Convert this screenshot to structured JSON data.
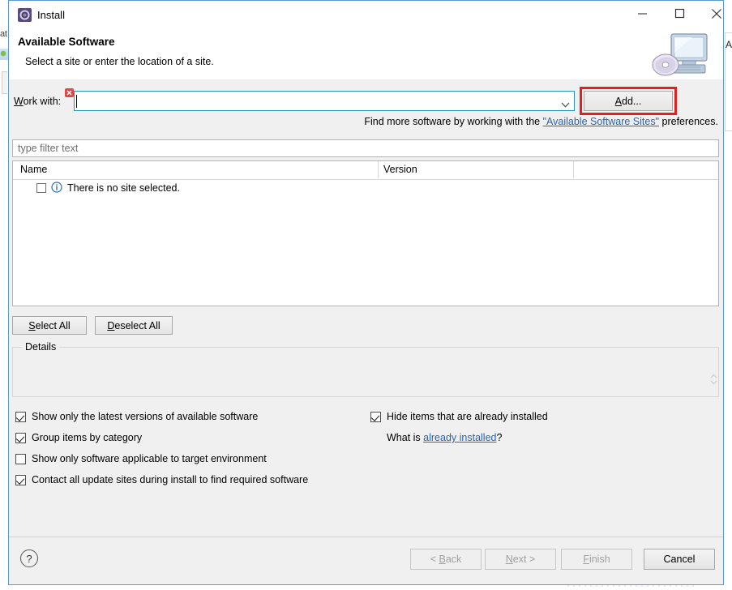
{
  "background": {
    "left_text": "at",
    "right_letter": "A"
  },
  "window": {
    "title": "Install",
    "icon": "install-wizard-icon",
    "minimize_label": "minimize-icon",
    "maximize_label": "maximize-icon",
    "close_label": "close-icon"
  },
  "header": {
    "title": "Available Software",
    "subtitle": "Select a site or enter the location of a site.",
    "banner_icon": "computer-with-cd-icon"
  },
  "work_with": {
    "label_pre": "W",
    "label_mnemonic": "W",
    "label": "Work with:",
    "value": "",
    "error_icon": "error-decoration-icon",
    "dropdown_icon": "chevron-down-icon",
    "add_button": "Add...",
    "add_button_mnemonic": "A",
    "highlight_color": "#e32020"
  },
  "find_more": {
    "prefix": "Find more software by working with the ",
    "link": "\"Available Software Sites\"",
    "suffix": " preferences."
  },
  "filter": {
    "placeholder": "type filter text",
    "value": ""
  },
  "table": {
    "columns": [
      "Name",
      "Version"
    ],
    "rows": [
      {
        "checked": false,
        "icon": "info-icon",
        "name": "There is no site selected.",
        "version": ""
      }
    ]
  },
  "list_buttons": {
    "select_all": "Select All",
    "select_all_mnemonic": "S",
    "deselect_all": "Deselect All",
    "deselect_all_mnemonic": "D"
  },
  "details": {
    "title": "Details",
    "content": "",
    "spinner_icon": "up-down-spinner-icon"
  },
  "options": {
    "left": [
      {
        "label": "Show only the latest versions of available software",
        "checked": true,
        "mnemonic": "l"
      },
      {
        "label": "Group items by category",
        "checked": true,
        "mnemonic": "G"
      },
      {
        "label": "Show only software applicable to target environment",
        "checked": false,
        "mnemonic": ""
      },
      {
        "label": "Contact all update sites during install to find required software",
        "checked": true,
        "mnemonic": "C"
      }
    ],
    "right": [
      {
        "label": "Hide items that are already installed",
        "checked": true,
        "mnemonic": "H"
      }
    ],
    "what_is_prefix": "What is ",
    "what_is_link": "already installed",
    "what_is_suffix": "?"
  },
  "footer": {
    "help_icon": "?",
    "buttons": [
      {
        "label": "< Back",
        "enabled": false,
        "name": "back-button"
      },
      {
        "label": "Next >",
        "enabled": false,
        "name": "next-button"
      },
      {
        "label": "Finish",
        "enabled": false,
        "name": "finish-button"
      },
      {
        "label": "Cancel",
        "enabled": true,
        "name": "cancel-button"
      }
    ]
  }
}
